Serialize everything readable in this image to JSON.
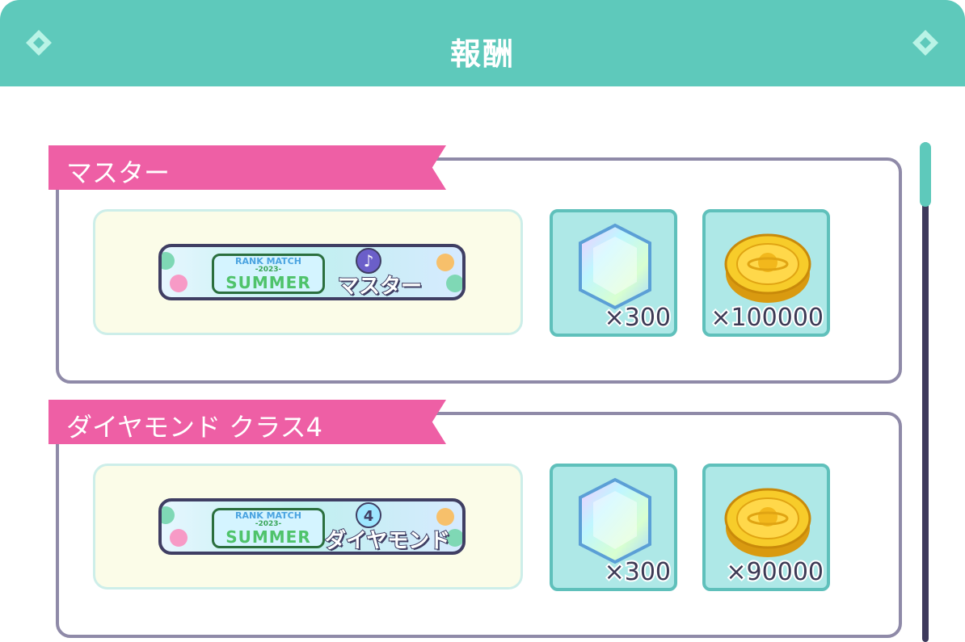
{
  "header": {
    "title": "報酬",
    "left_icon": "diamond-icon",
    "right_icon": "diamond-icon",
    "color": "#5ec9bb"
  },
  "rewards": [
    {
      "tier_label": "マスター",
      "frame": {
        "line1": "RANK MATCH",
        "line2": "-2023-",
        "line3": "SUMMER",
        "tier_text": "マスター",
        "icon": "music-note-badge-icon"
      },
      "items": [
        {
          "icon": "crystal-gem-icon",
          "quantity": "×300"
        },
        {
          "icon": "gold-coin-icon",
          "quantity": "×100000"
        }
      ]
    },
    {
      "tier_label": "ダイヤモンド クラス4",
      "frame": {
        "line1": "RANK MATCH",
        "line2": "-2023-",
        "line3": "SUMMER",
        "tier_text": "ダイヤモンド",
        "icon": "diamond-class-4-badge-icon"
      },
      "items": [
        {
          "icon": "crystal-gem-icon",
          "quantity": "×300"
        },
        {
          "icon": "gold-coin-icon",
          "quantity": "×90000"
        }
      ]
    }
  ],
  "colors": {
    "ribbon": "#ee5fa5",
    "panel_border": "#8f8aa8",
    "tile_bg": "#aee8e7",
    "tile_border": "#5fc0bb",
    "scroll_thumb": "#5ec9bb"
  }
}
